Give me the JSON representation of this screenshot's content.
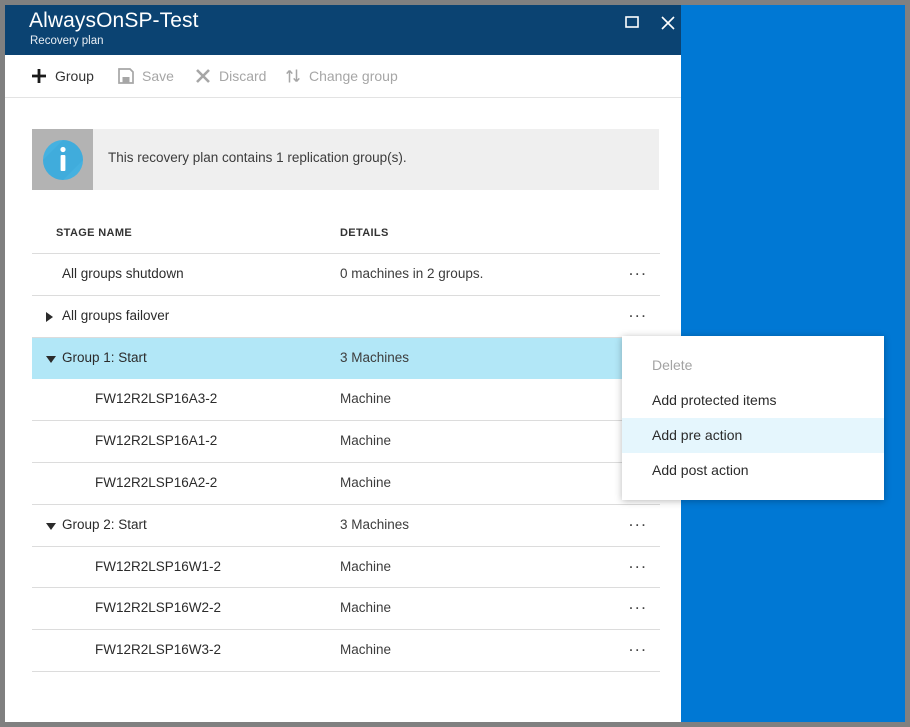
{
  "window": {
    "title": "AlwaysOnSP-Test",
    "subtitle": "Recovery plan",
    "maximize_icon": "maximize-icon",
    "close_icon": "close-icon"
  },
  "commandbar": {
    "items": [
      {
        "label": "Group",
        "icon": "plus-icon",
        "enabled": true
      },
      {
        "label": "Save",
        "icon": "save-disk-icon",
        "enabled": false
      },
      {
        "label": "Discard",
        "icon": "x-cross-icon",
        "enabled": false
      },
      {
        "label": "Change group",
        "icon": "swap-arrows-icon",
        "enabled": false
      }
    ]
  },
  "info": {
    "icon": "info-circle-icon",
    "message": "This recovery plan contains 1 replication group(s)."
  },
  "table": {
    "columns": [
      "STAGE NAME",
      "DETAILS"
    ],
    "rows": [
      {
        "stage": "All groups shutdown",
        "details": "0 machines in 2 groups.",
        "type": "stage",
        "caret": "none",
        "selected": false,
        "menu": "..."
      },
      {
        "stage": "All groups failover",
        "details": "",
        "type": "stage",
        "caret": "collapsed",
        "selected": false,
        "menu": "..."
      },
      {
        "stage": "Group 1: Start",
        "details": "3 Machines",
        "type": "group",
        "caret": "expanded",
        "selected": true,
        "menu": "..."
      },
      {
        "stage": "FW12R2LSP16A3-2",
        "details": "Machine",
        "type": "machine",
        "caret": "none",
        "selected": false,
        "menu": "..."
      },
      {
        "stage": "FW12R2LSP16A1-2",
        "details": "Machine",
        "type": "machine",
        "caret": "none",
        "selected": false,
        "menu": "..."
      },
      {
        "stage": "FW12R2LSP16A2-2",
        "details": "Machine",
        "type": "machine",
        "caret": "none",
        "selected": false,
        "menu": "..."
      },
      {
        "stage": "Group 2: Start",
        "details": "3 Machines",
        "type": "group",
        "caret": "expanded",
        "selected": false,
        "menu": "..."
      },
      {
        "stage": "FW12R2LSP16W1-2",
        "details": "Machine",
        "type": "machine",
        "caret": "none",
        "selected": false,
        "menu": "..."
      },
      {
        "stage": "FW12R2LSP16W2-2",
        "details": "Machine",
        "type": "machine",
        "caret": "none",
        "selected": false,
        "menu": "..."
      },
      {
        "stage": "FW12R2LSP16W3-2",
        "details": "Machine",
        "type": "machine",
        "caret": "none",
        "selected": false,
        "menu": "..."
      }
    ]
  },
  "context_menu": {
    "items": [
      {
        "label": "Delete",
        "enabled": false,
        "hovered": false
      },
      {
        "label": "Add protected items",
        "enabled": true,
        "hovered": false
      },
      {
        "label": "Add pre action",
        "enabled": true,
        "hovered": true
      },
      {
        "label": "Add post action",
        "enabled": true,
        "hovered": false
      }
    ]
  },
  "colors": {
    "title_bar": "#0b4372",
    "portal_background": "#0078d4",
    "selected_row": "#b2e7f7",
    "menu_hover": "#e5f6fd",
    "info_bar": "#efefef",
    "info_icon": "#45b1e0",
    "frame": "#808080"
  }
}
